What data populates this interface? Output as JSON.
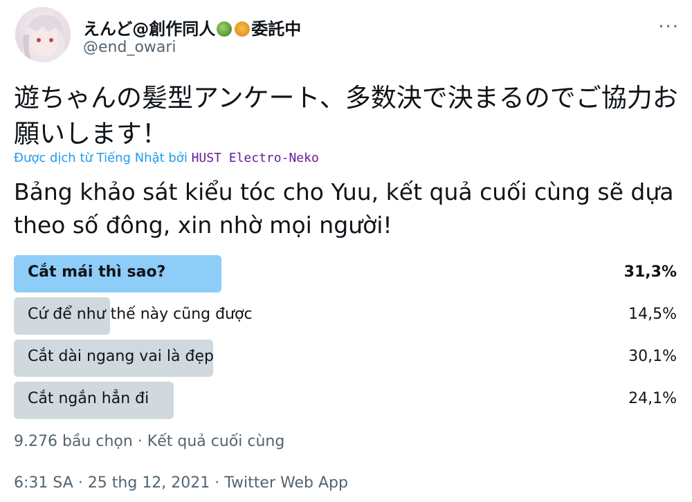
{
  "author": {
    "display_name": "えんど@創作同人",
    "display_name_suffix": "委託中",
    "emojis": [
      "melon-emoji",
      "tiger-emoji"
    ],
    "handle": "@end_owari"
  },
  "menu_label": "···",
  "tweet": {
    "original_text": "遊ちゃんの髪型アンケート、多数決で決まるのでご協力お願いします！",
    "translated_prefix": "Được dịch từ Tiếng Nhật bởi",
    "translator": "HUST Electro-Neko",
    "translated_text": "Bảng khảo sát kiểu tóc cho Yuu, kết quả cuối cùng sẽ dựa theo số đông, xin nhờ mọi người!"
  },
  "poll": {
    "options": [
      {
        "label": "Cắt mái thì sao?",
        "percent_text": "31,3%",
        "percent": 31.3,
        "winner": true
      },
      {
        "label": "Cứ để như thế này cũng được",
        "percent_text": "14,5%",
        "percent": 14.5,
        "winner": false
      },
      {
        "label": "Cắt dài ngang vai là đẹp",
        "percent_text": "30,1%",
        "percent": 30.1,
        "winner": false
      },
      {
        "label": "Cắt ngắn hẳn đi",
        "percent_text": "24,1%",
        "percent": 24.1,
        "winner": false
      }
    ],
    "footer": "9.276 bầu chọn · Kết quả cuối cùng"
  },
  "meta": {
    "timestamp": "6:31 SA · 25 thg 12, 2021 · Twitter Web App"
  },
  "colors": {
    "winner_bar": "#8ecdf8",
    "bar": "#cfd9de",
    "link": "#1d9bf0",
    "translator": "#6a1b9a",
    "secondary_text": "#536471"
  }
}
